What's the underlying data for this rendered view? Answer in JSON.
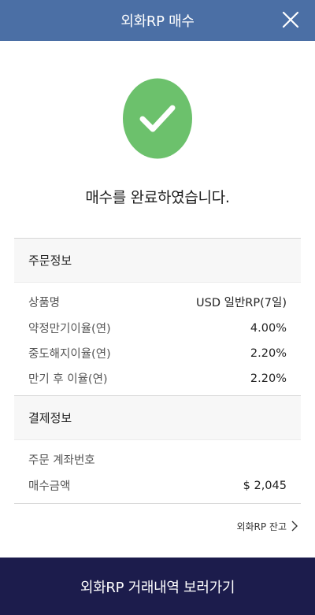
{
  "header": {
    "title": "외화RP 매수",
    "close_icon": "close-icon"
  },
  "status": {
    "icon": "check-circle-icon",
    "message": "매수를 완료하였습니다.",
    "accent": "#6cc16c"
  },
  "order_info": {
    "title": "주문정보",
    "rows": [
      {
        "label": "상품명",
        "value": "USD 일반RP(7일)"
      },
      {
        "label": "약정만기이율(연)",
        "value": "4.00%"
      },
      {
        "label": "중도해지이율(연)",
        "value": "2.20%"
      },
      {
        "label": "만기 후 이율(연)",
        "value": "2.20%"
      }
    ]
  },
  "payment_info": {
    "title": "결제정보",
    "rows": [
      {
        "label": "주문 계좌번호",
        "value": ""
      },
      {
        "label": "매수금액",
        "value": "$ 2,045"
      }
    ]
  },
  "balance_link": {
    "label": "외화RP 잔고",
    "icon": "chevron-right-icon"
  },
  "cta": {
    "label": "외화RP 거래내역 보러가기"
  },
  "colors": {
    "header_bg": "#4b6fa5",
    "cta_bg": "#1c1c4c",
    "success": "#6cc16c"
  }
}
